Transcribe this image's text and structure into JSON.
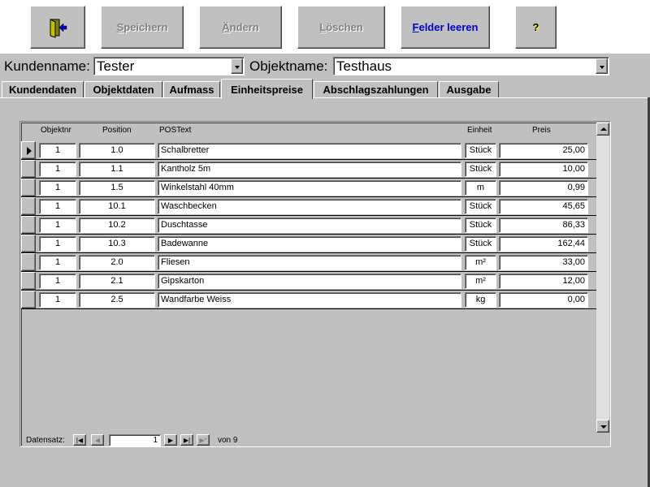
{
  "toolbar": {
    "exit_icon": "exit-door-icon",
    "save_label": "Speichern",
    "save_accel": "S",
    "save_rest": "peichern",
    "change_accel": "Ä",
    "change_rest": "ndern",
    "delete_accel": "L",
    "delete_rest": "öschen",
    "clear_accel": "F",
    "clear_rest": "elder leeren",
    "help_label": "?"
  },
  "header": {
    "customer_label": "Kundenname:",
    "customer_value": "Tester",
    "object_label": "Objektname:",
    "object_value": "Testhaus"
  },
  "tabs": [
    {
      "label": "Kundendaten"
    },
    {
      "label": "Objektdaten"
    },
    {
      "label": "Aufmass"
    },
    {
      "label": "Einheitspreise"
    },
    {
      "label": "Abschlagszahlungen"
    },
    {
      "label": "Ausgabe"
    }
  ],
  "active_tab": "Einheitspreise",
  "grid": {
    "columns": [
      "Objektnr",
      "Position",
      "POSText",
      "Einheit",
      "Preis"
    ],
    "rows": [
      {
        "objektnr": "1",
        "position": "1.0",
        "text": "Schalbretter",
        "einheit": "Stück",
        "preis": "25,00"
      },
      {
        "objektnr": "1",
        "position": "1.1",
        "text": "Kantholz 5m",
        "einheit": "Stück",
        "preis": "10,00"
      },
      {
        "objektnr": "1",
        "position": "1.5",
        "text": "Winkelstahl 40mm",
        "einheit": "m",
        "preis": "0,99"
      },
      {
        "objektnr": "1",
        "position": "10.1",
        "text": "Waschbecken",
        "einheit": "Stück",
        "preis": "45,65"
      },
      {
        "objektnr": "1",
        "position": "10.2",
        "text": "Duschtasse",
        "einheit": "Stück",
        "preis": "86,33"
      },
      {
        "objektnr": "1",
        "position": "10.3",
        "text": "Badewanne",
        "einheit": "Stück",
        "preis": "162,44"
      },
      {
        "objektnr": "1",
        "position": "2.0",
        "text": "Fliesen",
        "einheit": "m²",
        "preis": "33,00"
      },
      {
        "objektnr": "1",
        "position": "2.1",
        "text": "Gipskarton",
        "einheit": "m²",
        "preis": "12,00"
      },
      {
        "objektnr": "1",
        "position": "2.5",
        "text": "Wandfarbe Weiss",
        "einheit": "kg",
        "preis": "0,00"
      }
    ]
  },
  "navigation": {
    "label": "Datensatz:",
    "current": "1",
    "of_label": "von",
    "total": "9",
    "first_glyph": "|◀",
    "prev_glyph": "◀",
    "next_glyph": "▶",
    "last_glyph": "▶|",
    "new_glyph": "▶*"
  }
}
